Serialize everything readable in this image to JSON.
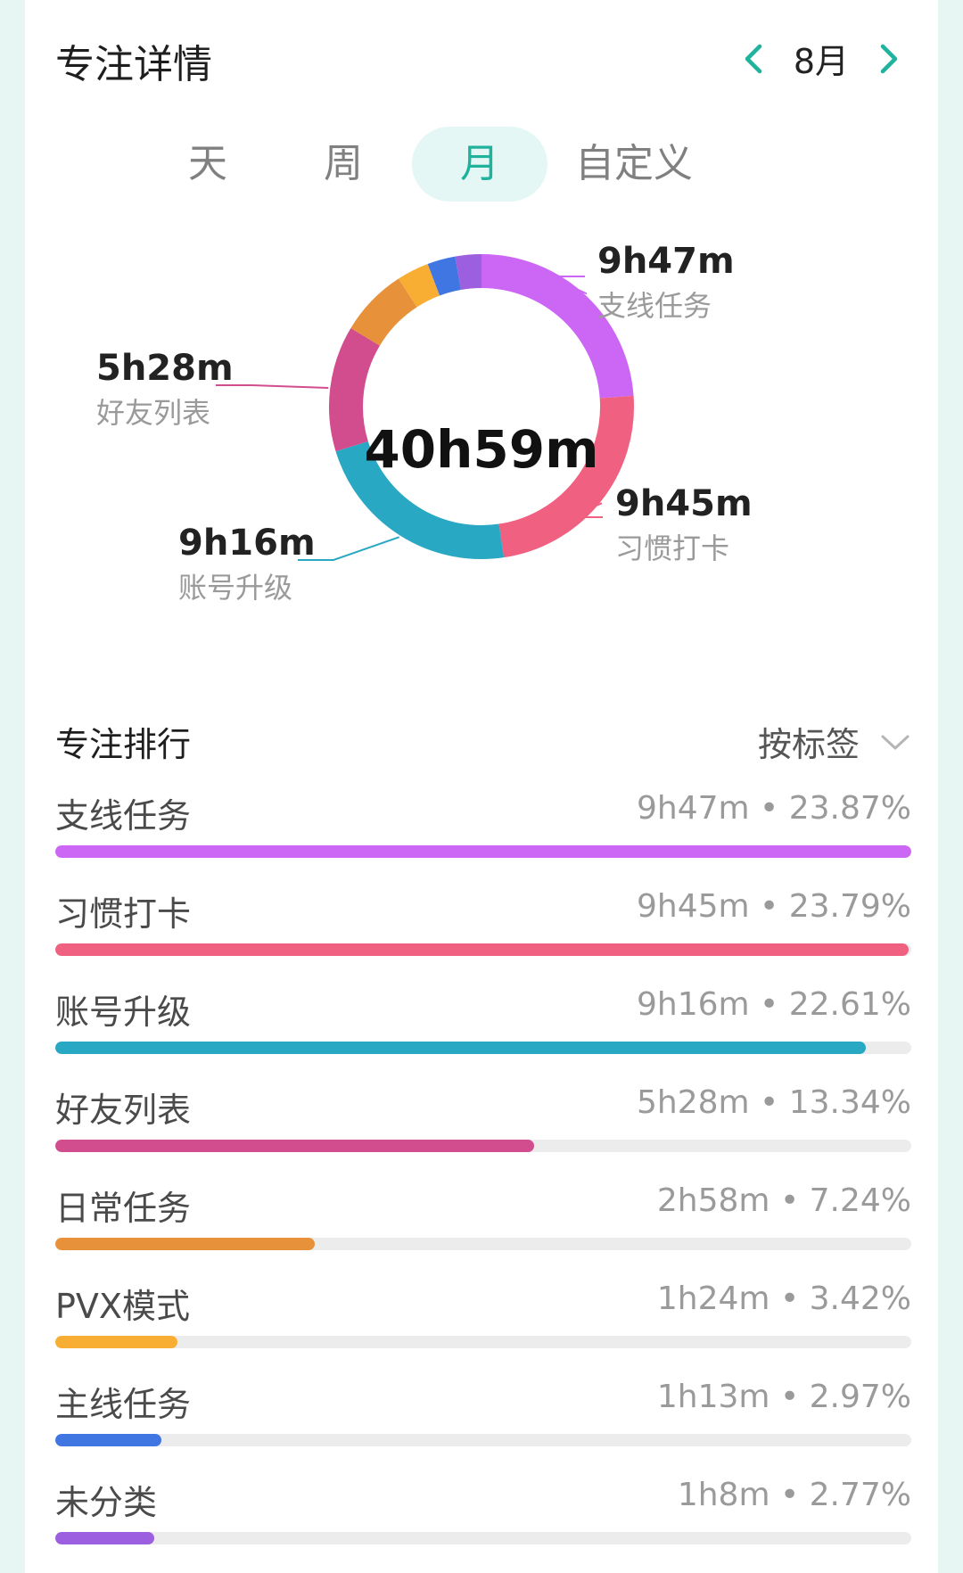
{
  "header": {
    "title": "专注详情",
    "month": "8月"
  },
  "tabs": [
    {
      "label": "天"
    },
    {
      "label": "周"
    },
    {
      "label": "月"
    },
    {
      "label": "自定义"
    }
  ],
  "chart_data": {
    "type": "pie",
    "center_label": "40h59m",
    "segments": [
      {
        "name": "支线任务",
        "value": 23.87,
        "time": "9h47m",
        "color": "#cc66f5"
      },
      {
        "name": "习惯打卡",
        "value": 23.79,
        "time": "9h45m",
        "color": "#f06080"
      },
      {
        "name": "账号升级",
        "value": 22.61,
        "time": "9h16m",
        "color": "#29a8c4"
      },
      {
        "name": "好友列表",
        "value": 13.34,
        "time": "5h28m",
        "color": "#d14d8e"
      },
      {
        "name": "日常任务",
        "value": 7.24,
        "time": "2h58m",
        "color": "#e8913b"
      },
      {
        "name": "PVX模式",
        "value": 3.42,
        "time": "1h24m",
        "color": "#f8ae33"
      },
      {
        "name": "主线任务",
        "value": 2.97,
        "time": "1h13m",
        "color": "#3f76e2"
      },
      {
        "name": "未分类",
        "value": 2.77,
        "time": "1h8m",
        "color": "#9b5fe0"
      }
    ]
  },
  "ranking": {
    "title": "专注排行",
    "sort_label": "按标签",
    "rows": [
      {
        "name": "支线任务",
        "stat": "9h47m • 23.87%",
        "fraction": 1.0,
        "color": "#cc66f5"
      },
      {
        "name": "习惯打卡",
        "stat": "9h45m • 23.79%",
        "fraction": 0.997,
        "color": "#f06080"
      },
      {
        "name": "账号升级",
        "stat": "9h16m • 22.61%",
        "fraction": 0.947,
        "color": "#29a8c4"
      },
      {
        "name": "好友列表",
        "stat": "5h28m • 13.34%",
        "fraction": 0.559,
        "color": "#d14d8e"
      },
      {
        "name": "日常任务",
        "stat": "2h58m • 7.24%",
        "fraction": 0.303,
        "color": "#e8913b"
      },
      {
        "name": "PVX模式",
        "stat": "1h24m • 3.42%",
        "fraction": 0.143,
        "color": "#f8ae33"
      },
      {
        "name": "主线任务",
        "stat": "1h13m • 2.97%",
        "fraction": 0.124,
        "color": "#3f76e2"
      },
      {
        "name": "未分类",
        "stat": "1h8m • 2.77%",
        "fraction": 0.116,
        "color": "#9b5fe0"
      }
    ]
  }
}
